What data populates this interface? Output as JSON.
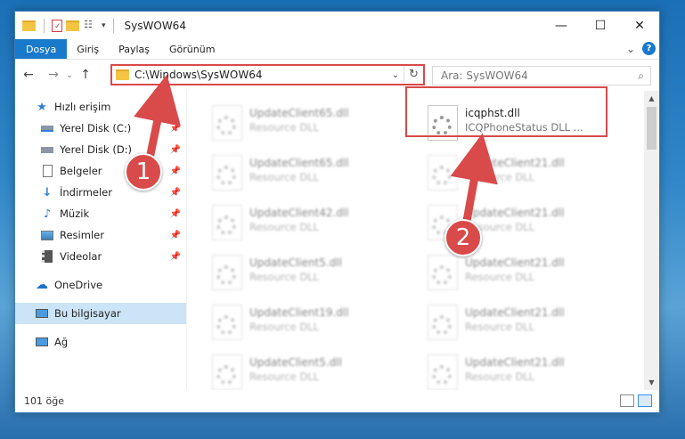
{
  "window": {
    "title": "SysWOW64",
    "controls": [
      "—",
      "☐",
      "✕"
    ]
  },
  "ribbon": {
    "tabs": [
      "Dosya",
      "Giriş",
      "Paylaş",
      "Görünüm"
    ],
    "active_tab": "Dosya",
    "collapse": "⌄",
    "help": "?"
  },
  "navigation": {
    "back": "←",
    "forward": "→",
    "recent": "⌄",
    "up": "↑",
    "address": "C:\\Windows\\SysWOW64",
    "address_dropdown": "⌄",
    "refresh": "↻",
    "search_placeholder": "Ara: SysWOW64",
    "search_icon": "⌕"
  },
  "sidebar": {
    "quick_access": "Hızlı erişim",
    "items": [
      {
        "label": "Yerel Disk (C:)",
        "icon": "drive-icon"
      },
      {
        "label": "Yerel Disk (D:)",
        "icon": "drive-icon"
      },
      {
        "label": "Belgeler",
        "icon": "documents-icon"
      },
      {
        "label": "İndirmeler",
        "icon": "downloads-icon"
      },
      {
        "label": "Müzik",
        "icon": "music-icon"
      },
      {
        "label": "Resimler",
        "icon": "pictures-icon"
      },
      {
        "label": "Videolar",
        "icon": "videos-icon"
      }
    ],
    "onedrive": "OneDrive",
    "this_pc": "Bu bilgisayar",
    "network": "Ağ"
  },
  "files": {
    "left_column": [
      {
        "name": "UpdateClient65.dll",
        "type": "Resource DLL"
      },
      {
        "name": "UpdateClient65.dll",
        "type": "Resource DLL"
      },
      {
        "name": "UpdateClient42.dll",
        "type": "Resource DLL"
      },
      {
        "name": "UpdateClient5.dll",
        "type": "Resource DLL"
      },
      {
        "name": "UpdateClient19.dll",
        "type": "Resource DLL"
      },
      {
        "name": "UpdateClient5.dll",
        "type": "Resource DLL"
      }
    ],
    "right_column": [
      {
        "name": "icqphst.dll",
        "type": "ICQPhoneStatus DLL ..."
      },
      {
        "name": "UpdateClient21.dll",
        "type": "Resource DLL"
      },
      {
        "name": "UpdateClient21.dll",
        "type": "Resource DLL"
      },
      {
        "name": "UpdateClient21.dll",
        "type": "Resource DLL"
      },
      {
        "name": "UpdateClient21.dll",
        "type": "Resource DLL"
      },
      {
        "name": "UpdateClient21.dll",
        "type": "Resource DLL"
      }
    ]
  },
  "status": {
    "count": "101 öğe"
  },
  "annotations": {
    "step1": "1",
    "step2": "2",
    "color": "#d94a4a"
  }
}
